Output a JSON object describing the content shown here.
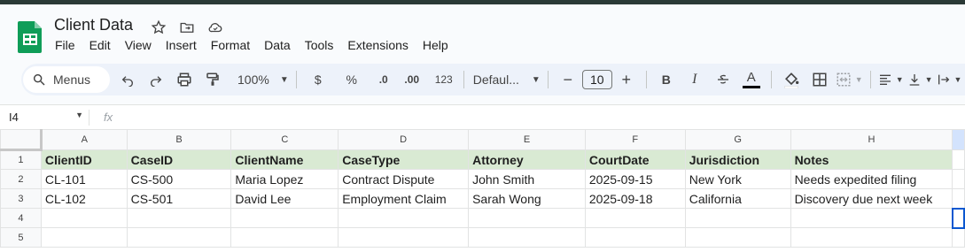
{
  "app": {
    "title": "Client Data",
    "menus": [
      "File",
      "Edit",
      "View",
      "Insert",
      "Format",
      "Data",
      "Tools",
      "Extensions",
      "Help"
    ]
  },
  "toolbar": {
    "menus_label": "Menus",
    "zoom": "100%",
    "currency": "$",
    "percent": "%",
    "decrease_decimal": ".0",
    "increase_decimal": ".00",
    "number_format": "123",
    "font": "Defaul...",
    "font_size": "10",
    "bold": "B",
    "italic": "I",
    "text_color": "A"
  },
  "formula_bar": {
    "cell_ref": "I4",
    "fx": "fx",
    "value": ""
  },
  "grid": {
    "columns": [
      "A",
      "B",
      "C",
      "D",
      "E",
      "F",
      "G",
      "H"
    ],
    "rows": [
      {
        "num": "1",
        "cells": [
          "ClientID",
          "CaseID",
          "ClientName",
          "CaseType",
          "Attorney",
          "CourtDate",
          "Jurisdiction",
          "Notes"
        ]
      },
      {
        "num": "2",
        "cells": [
          "CL-101",
          "CS-500",
          "Maria Lopez",
          "Contract Dispute",
          "John Smith",
          "2025-09-15",
          "New York",
          "Needs expedited filing"
        ]
      },
      {
        "num": "3",
        "cells": [
          "CL-102",
          "CS-501",
          "David Lee",
          "Employment Claim",
          "Sarah Wong",
          "2025-09-18",
          "California",
          "Discovery due next week"
        ]
      },
      {
        "num": "4",
        "cells": [
          "",
          "",
          "",
          "",
          "",
          "",
          "",
          ""
        ]
      },
      {
        "num": "5",
        "cells": [
          "",
          "",
          "",
          "",
          "",
          "",
          "",
          ""
        ]
      }
    ]
  },
  "colors": {
    "header_fill": "#d9ead3",
    "brand": "#0f9d58",
    "selected": "#0b57d0"
  }
}
